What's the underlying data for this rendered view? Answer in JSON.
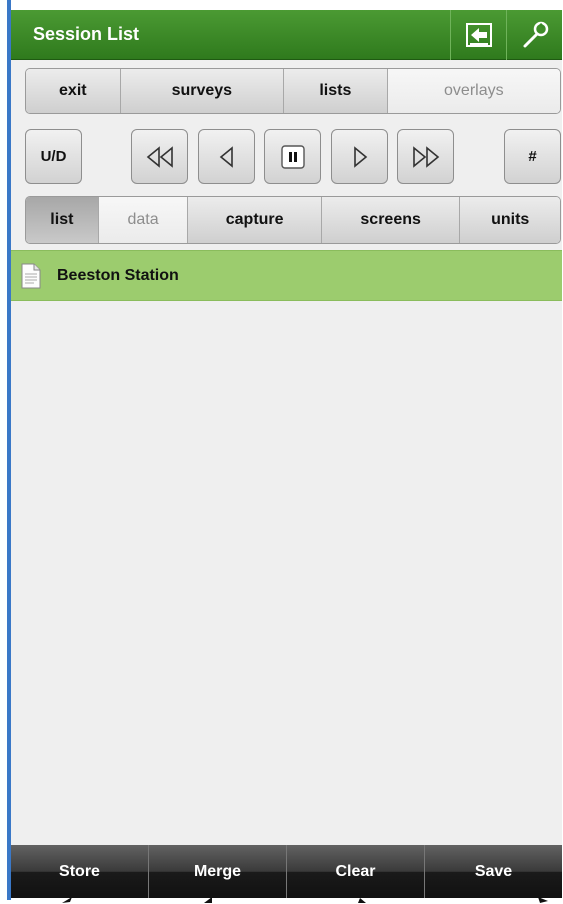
{
  "header": {
    "title": "Session List",
    "back_icon": "back-arrow-icon",
    "settings_icon": "wrench-icon"
  },
  "nav": {
    "tabs": [
      {
        "label": "exit"
      },
      {
        "label": "surveys"
      },
      {
        "label": "lists"
      },
      {
        "label": "overlays"
      }
    ]
  },
  "transport": {
    "ud_label": "U/D",
    "hash_label": "#"
  },
  "views": {
    "tabs": [
      {
        "label": "list"
      },
      {
        "label": "data"
      },
      {
        "label": "capture"
      },
      {
        "label": "screens"
      },
      {
        "label": "units"
      }
    ]
  },
  "sessions": [
    {
      "name": "Beeston Station",
      "icon": "document-icon"
    }
  ],
  "footer": {
    "store": "Store",
    "merge": "Merge",
    "clear": "Clear",
    "save": "Save"
  },
  "colors": {
    "header": "#3a8a27",
    "selected_row": "#9ccc6e",
    "footer": "#1c1c1c"
  }
}
